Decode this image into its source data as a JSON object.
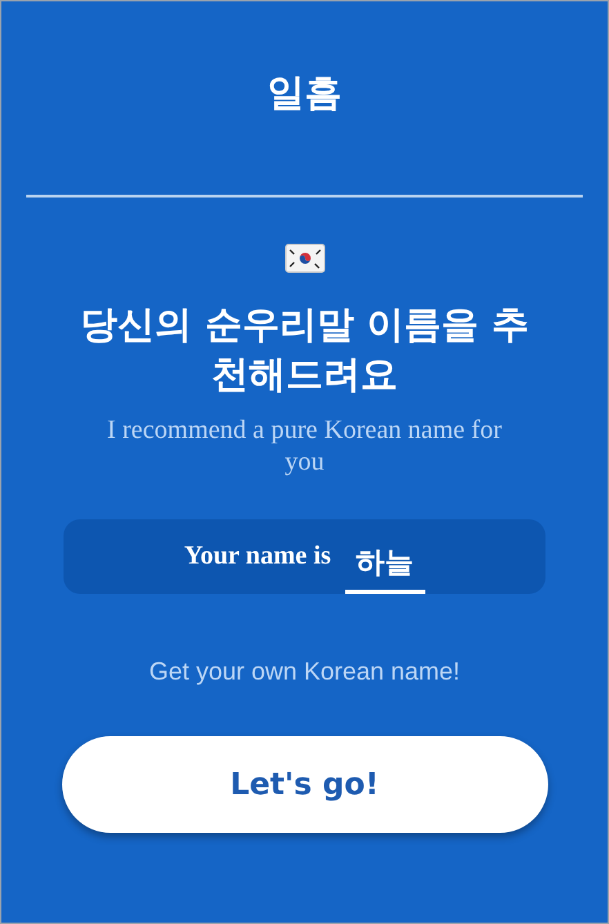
{
  "header": {
    "title": "일흠"
  },
  "headline": "당신의 순우리말 이름을 추천해드려요",
  "subtitle": "I recommend a pure Korean name for you",
  "name_panel": {
    "label": "Your name is",
    "name": "하늘"
  },
  "prompt": "Get your own Korean name!",
  "button": "Let's go!"
}
